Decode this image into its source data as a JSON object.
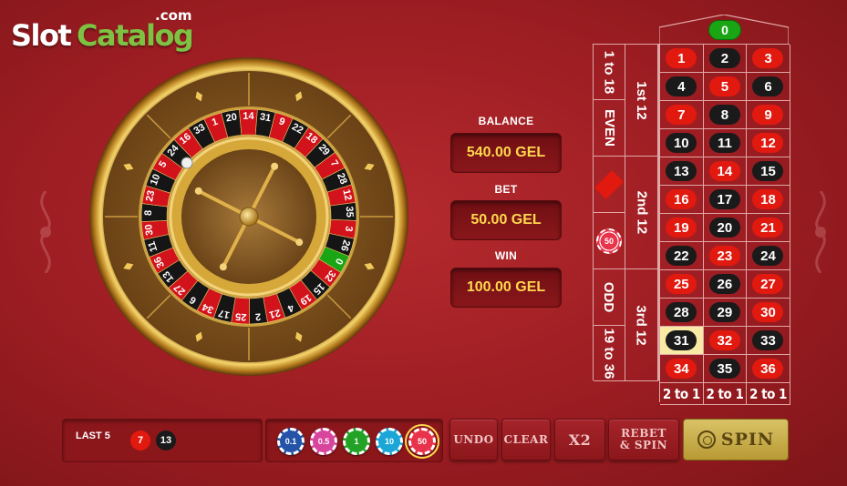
{
  "logo": {
    "slot": "Slot",
    "catalog": "Catalog",
    "dotcom": ".com"
  },
  "wheel": {
    "numbers": [
      "0",
      "32",
      "15",
      "19",
      "4",
      "21",
      "2",
      "25",
      "17",
      "34",
      "6",
      "27",
      "13",
      "36",
      "11",
      "30",
      "8",
      "23",
      "10",
      "5",
      "24",
      "16",
      "33",
      "1",
      "20",
      "14",
      "31",
      "9",
      "22",
      "18",
      "29",
      "7",
      "28",
      "12",
      "35",
      "3",
      "26"
    ],
    "red_numbers": [
      "1",
      "3",
      "5",
      "7",
      "9",
      "12",
      "14",
      "16",
      "18",
      "19",
      "21",
      "23",
      "25",
      "27",
      "30",
      "32",
      "34",
      "36"
    ]
  },
  "info": {
    "balance_label": "BALANCE",
    "balance_value": "540.00 GEL",
    "bet_label": "BET",
    "bet_value": "50.00 GEL",
    "win_label": "WIN",
    "win_value": "100.00 GEL"
  },
  "table": {
    "zero": "0",
    "rows": [
      [
        "1",
        "2",
        "3"
      ],
      [
        "4",
        "5",
        "6"
      ],
      [
        "7",
        "8",
        "9"
      ],
      [
        "10",
        "11",
        "12"
      ],
      [
        "13",
        "14",
        "15"
      ],
      [
        "16",
        "17",
        "18"
      ],
      [
        "19",
        "20",
        "21"
      ],
      [
        "22",
        "23",
        "24"
      ],
      [
        "25",
        "26",
        "27"
      ],
      [
        "28",
        "29",
        "30"
      ],
      [
        "31",
        "32",
        "33"
      ],
      [
        "34",
        "35",
        "36"
      ]
    ],
    "two_to_one": [
      "2 to 1",
      "2 to 1",
      "2 to 1"
    ],
    "dozens": [
      "1st 12",
      "2nd 12",
      "3rd 12"
    ],
    "outside": {
      "low": "1 to 18",
      "even": "EVEN",
      "odd": "ODD",
      "high": "19 to 36"
    },
    "highlighted_number": "31",
    "placed_chip": "50"
  },
  "last5": {
    "label": "LAST 5",
    "results": [
      {
        "num": "7",
        "color": "#e1190f"
      },
      {
        "num": "13",
        "color": "#1a1a1a"
      }
    ]
  },
  "chips": [
    {
      "value": "0.1",
      "color": "#2553a8"
    },
    {
      "value": "0.5",
      "color": "#d8459c"
    },
    {
      "value": "1",
      "color": "#23a325"
    },
    {
      "value": "10",
      "color": "#1aa6d6"
    },
    {
      "value": "50",
      "color": "#e8334a",
      "selected": true
    }
  ],
  "buttons": {
    "undo": "UNDO",
    "clear": "CLEAR",
    "x2": "X2",
    "rebet_line1": "REBET",
    "rebet_line2": "& SPIN",
    "spin": "SPIN"
  }
}
